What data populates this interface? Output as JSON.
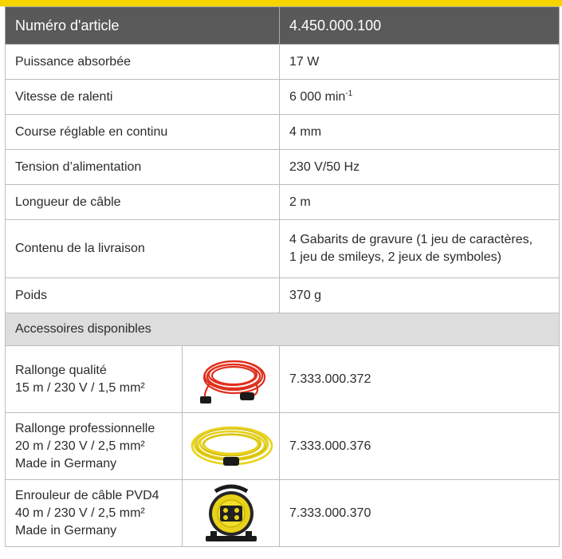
{
  "header": {
    "label": "Numéro d'article",
    "value": "4.450.000.100"
  },
  "specs": [
    {
      "label": "Puissance absorbée",
      "value": "17 W"
    },
    {
      "label": "Vitesse de ralenti",
      "value": "6 000 min",
      "value_sup": "-1"
    },
    {
      "label": "Course réglable en continu",
      "value": "4 mm"
    },
    {
      "label": "Tension d’alimentation",
      "value": "230 V/50 Hz"
    },
    {
      "label": "Longueur de câble",
      "value": "2 m"
    },
    {
      "label": "Contenu de la livraison",
      "value_line1": "4 Gabarits de gravure (1 jeu de caractères,",
      "value_line2": "1 jeu de smileys, 2 jeux de symboles)"
    },
    {
      "label": "Poids",
      "value": "370 g"
    }
  ],
  "accessories_title": "Accessoires disponibles",
  "accessories": [
    {
      "line1": "Rallonge qualité",
      "line2": "15 m / 230 V / 1,5 mm²",
      "line3": "",
      "number": "7.333.000.372",
      "image": "red-extension-cable"
    },
    {
      "line1": "Rallonge professionnelle",
      "line2": "20 m / 230 V / 2,5 mm²",
      "line3": "Made in Germany",
      "number": "7.333.000.376",
      "image": "yellow-extension-cable"
    },
    {
      "line1": "Enrouleur de câble PVD4",
      "line2": "40 m / 230 V / 2,5 mm²",
      "line3": "Made in Germany",
      "number": "7.333.000.370",
      "image": "cable-reel"
    }
  ],
  "colors": {
    "accent": "#f5d400",
    "header_bg": "#595959",
    "section_bg": "#dddddd",
    "border": "#bdbdbd"
  }
}
